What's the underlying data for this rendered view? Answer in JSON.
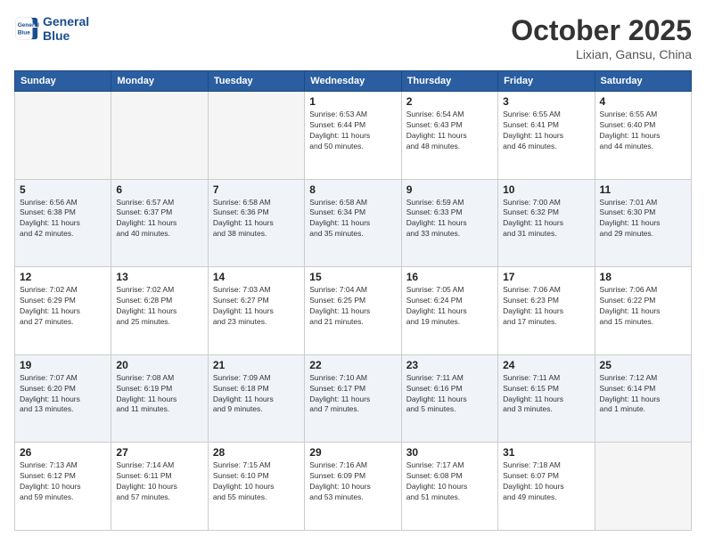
{
  "header": {
    "logo_line1": "General",
    "logo_line2": "Blue",
    "month": "October 2025",
    "location": "Lixian, Gansu, China"
  },
  "weekdays": [
    "Sunday",
    "Monday",
    "Tuesday",
    "Wednesday",
    "Thursday",
    "Friday",
    "Saturday"
  ],
  "weeks": [
    [
      {
        "day": "",
        "info": ""
      },
      {
        "day": "",
        "info": ""
      },
      {
        "day": "",
        "info": ""
      },
      {
        "day": "1",
        "info": "Sunrise: 6:53 AM\nSunset: 6:44 PM\nDaylight: 11 hours\nand 50 minutes."
      },
      {
        "day": "2",
        "info": "Sunrise: 6:54 AM\nSunset: 6:43 PM\nDaylight: 11 hours\nand 48 minutes."
      },
      {
        "day": "3",
        "info": "Sunrise: 6:55 AM\nSunset: 6:41 PM\nDaylight: 11 hours\nand 46 minutes."
      },
      {
        "day": "4",
        "info": "Sunrise: 6:55 AM\nSunset: 6:40 PM\nDaylight: 11 hours\nand 44 minutes."
      }
    ],
    [
      {
        "day": "5",
        "info": "Sunrise: 6:56 AM\nSunset: 6:38 PM\nDaylight: 11 hours\nand 42 minutes."
      },
      {
        "day": "6",
        "info": "Sunrise: 6:57 AM\nSunset: 6:37 PM\nDaylight: 11 hours\nand 40 minutes."
      },
      {
        "day": "7",
        "info": "Sunrise: 6:58 AM\nSunset: 6:36 PM\nDaylight: 11 hours\nand 38 minutes."
      },
      {
        "day": "8",
        "info": "Sunrise: 6:58 AM\nSunset: 6:34 PM\nDaylight: 11 hours\nand 35 minutes."
      },
      {
        "day": "9",
        "info": "Sunrise: 6:59 AM\nSunset: 6:33 PM\nDaylight: 11 hours\nand 33 minutes."
      },
      {
        "day": "10",
        "info": "Sunrise: 7:00 AM\nSunset: 6:32 PM\nDaylight: 11 hours\nand 31 minutes."
      },
      {
        "day": "11",
        "info": "Sunrise: 7:01 AM\nSunset: 6:30 PM\nDaylight: 11 hours\nand 29 minutes."
      }
    ],
    [
      {
        "day": "12",
        "info": "Sunrise: 7:02 AM\nSunset: 6:29 PM\nDaylight: 11 hours\nand 27 minutes."
      },
      {
        "day": "13",
        "info": "Sunrise: 7:02 AM\nSunset: 6:28 PM\nDaylight: 11 hours\nand 25 minutes."
      },
      {
        "day": "14",
        "info": "Sunrise: 7:03 AM\nSunset: 6:27 PM\nDaylight: 11 hours\nand 23 minutes."
      },
      {
        "day": "15",
        "info": "Sunrise: 7:04 AM\nSunset: 6:25 PM\nDaylight: 11 hours\nand 21 minutes."
      },
      {
        "day": "16",
        "info": "Sunrise: 7:05 AM\nSunset: 6:24 PM\nDaylight: 11 hours\nand 19 minutes."
      },
      {
        "day": "17",
        "info": "Sunrise: 7:06 AM\nSunset: 6:23 PM\nDaylight: 11 hours\nand 17 minutes."
      },
      {
        "day": "18",
        "info": "Sunrise: 7:06 AM\nSunset: 6:22 PM\nDaylight: 11 hours\nand 15 minutes."
      }
    ],
    [
      {
        "day": "19",
        "info": "Sunrise: 7:07 AM\nSunset: 6:20 PM\nDaylight: 11 hours\nand 13 minutes."
      },
      {
        "day": "20",
        "info": "Sunrise: 7:08 AM\nSunset: 6:19 PM\nDaylight: 11 hours\nand 11 minutes."
      },
      {
        "day": "21",
        "info": "Sunrise: 7:09 AM\nSunset: 6:18 PM\nDaylight: 11 hours\nand 9 minutes."
      },
      {
        "day": "22",
        "info": "Sunrise: 7:10 AM\nSunset: 6:17 PM\nDaylight: 11 hours\nand 7 minutes."
      },
      {
        "day": "23",
        "info": "Sunrise: 7:11 AM\nSunset: 6:16 PM\nDaylight: 11 hours\nand 5 minutes."
      },
      {
        "day": "24",
        "info": "Sunrise: 7:11 AM\nSunset: 6:15 PM\nDaylight: 11 hours\nand 3 minutes."
      },
      {
        "day": "25",
        "info": "Sunrise: 7:12 AM\nSunset: 6:14 PM\nDaylight: 11 hours\nand 1 minute."
      }
    ],
    [
      {
        "day": "26",
        "info": "Sunrise: 7:13 AM\nSunset: 6:12 PM\nDaylight: 10 hours\nand 59 minutes."
      },
      {
        "day": "27",
        "info": "Sunrise: 7:14 AM\nSunset: 6:11 PM\nDaylight: 10 hours\nand 57 minutes."
      },
      {
        "day": "28",
        "info": "Sunrise: 7:15 AM\nSunset: 6:10 PM\nDaylight: 10 hours\nand 55 minutes."
      },
      {
        "day": "29",
        "info": "Sunrise: 7:16 AM\nSunset: 6:09 PM\nDaylight: 10 hours\nand 53 minutes."
      },
      {
        "day": "30",
        "info": "Sunrise: 7:17 AM\nSunset: 6:08 PM\nDaylight: 10 hours\nand 51 minutes."
      },
      {
        "day": "31",
        "info": "Sunrise: 7:18 AM\nSunset: 6:07 PM\nDaylight: 10 hours\nand 49 minutes."
      },
      {
        "day": "",
        "info": ""
      }
    ]
  ]
}
